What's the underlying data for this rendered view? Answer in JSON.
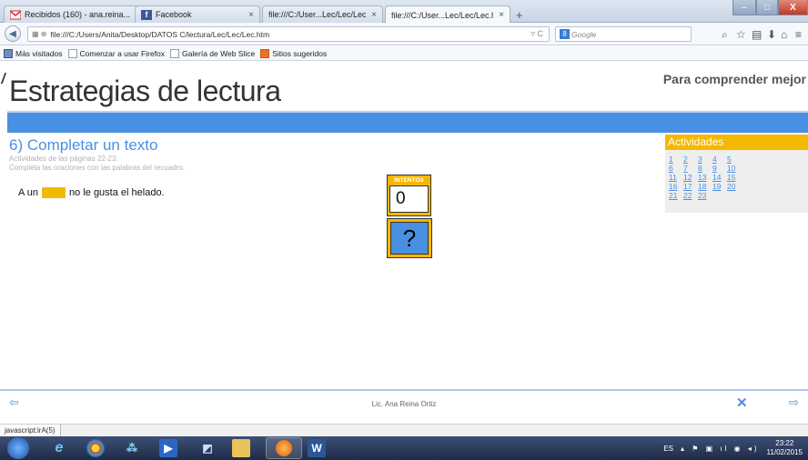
{
  "browser": {
    "tabs": [
      {
        "label": "Recibidos (160) - ana.reina...",
        "icon": "gmail-icon"
      },
      {
        "label": "Facebook",
        "icon": "facebook-icon"
      },
      {
        "label": "file:///C:/User...Lec/Lec/Lec.htm",
        "icon": ""
      },
      {
        "label": "file:///C:/User...Lec/Lec/Lec.htm",
        "icon": ""
      }
    ],
    "new_tab": "+",
    "close_glyph": "×",
    "url": "file:///C:/Users/Anita/Desktop/DATOS C/lectura/Lec/Lec/Lec.htm",
    "search_placeholder": "Google",
    "bookmarks": [
      "Más visitados",
      "Comenzar a usar Firefox",
      "Galería de Web Slice",
      "Sitios sugeridos"
    ],
    "window_min": "–",
    "window_max": "□",
    "window_close": "X"
  },
  "page": {
    "site_title": "Estrategias de lectura",
    "tagline": "Para comprender mejor",
    "section_title": "6) Completar un texto",
    "section_pages": "Actividades de las páginas 22-23.",
    "instructions": "Completa las oraciones con las palabras del recuadro.",
    "sentence_before": "A un",
    "sentence_after": "no le gusta el helado.",
    "attempts_label": "INTENTOS",
    "attempts_value": "0",
    "help_label": "?",
    "activities_title": "Actividades",
    "activities": [
      [
        "1",
        "2",
        "3",
        "4",
        "5"
      ],
      [
        "6",
        "7",
        "8",
        "9",
        "10"
      ],
      [
        "11",
        "12",
        "13",
        "14",
        "15"
      ],
      [
        "16",
        "17",
        "18",
        "19",
        "20"
      ],
      [
        "21",
        "22",
        "23"
      ]
    ],
    "footer_credit": "Lic. Ana Reina Ortiz"
  },
  "status": "javascript:irA(5)",
  "taskbar": {
    "lang": "ES",
    "time": "23:22",
    "date": "11/02/2015"
  },
  "colors": {
    "accent_blue": "#4a90e2",
    "accent_yellow": "#f5b800"
  }
}
